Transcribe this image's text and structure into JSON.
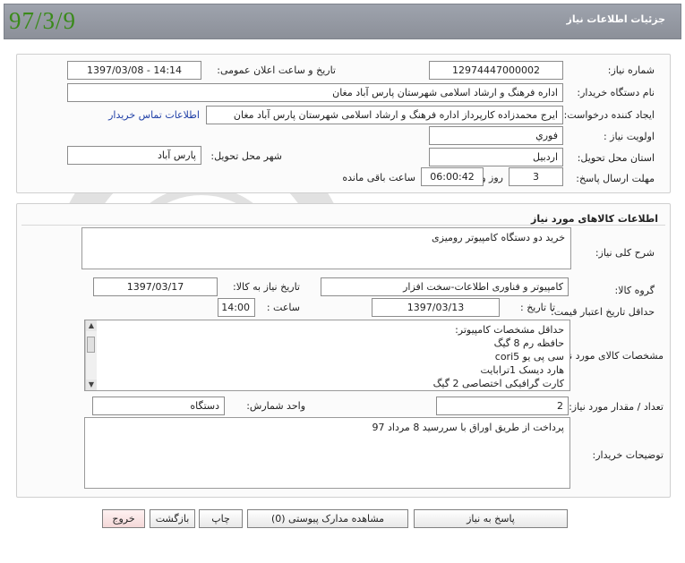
{
  "header": {
    "title": "جزئیات اطلاعات نیاز",
    "stamp": "97/3/9"
  },
  "info": {
    "need_number_label": "شماره نیاز:",
    "need_number": "12974447000002",
    "announce_label": "تاریخ و ساعت اعلان عمومی:",
    "announce_value": "1397/03/08 - 14:14",
    "buyer_label": "نام دستگاه خریدار:",
    "buyer": "اداره فرهنگ و ارشاد اسلامی شهرستان پارس آباد مغان",
    "requester_label": "ایجاد کننده درخواست:",
    "requester": "ایرج محمدزاده کارپرداز اداره فرهنگ و ارشاد اسلامی شهرستان پارس آباد مغان",
    "contact_link": "اطلاعات تماس خریدار",
    "priority_label": "اولویت نیاز :",
    "priority": "فوري",
    "province_label": "استان محل تحویل:",
    "province": "اردبیل",
    "city_label": "شهر محل تحویل:",
    "city": "پارس آباد",
    "deadline_label": "مهلت ارسال پاسخ:",
    "days": "3",
    "days_word": "روز و",
    "time": "06:00:42",
    "time_word": "ساعت باقی مانده"
  },
  "goods": {
    "section_title": "اطلاعات کالاهای مورد نیاز",
    "summary_label": "شرح کلی نیاز:",
    "summary": "خرید دو دستگاه کامپیوتر رومیزی",
    "group_label": "گروه کالا:",
    "group": "کامپیوتر و فناوری اطلاعات-سخت افزار",
    "need_date_label": "تاریخ نیاز به کالا:",
    "need_date": "1397/03/17",
    "validity_label": "حداقل تاریخ اعتبار قیمت:",
    "until_label": "تا تاریخ :",
    "until_date": "1397/03/13",
    "hour_label": "ساعت :",
    "hour": "14:00",
    "specs_label": "مشخصات کالای مورد نیاز:",
    "specs": [
      "حداقل مشخصات کامپیوتر:",
      "حافظه رم 8 گیگ",
      "سی پی یو cori5",
      "هارد دیسک 1ترابایت",
      "کارت گرافیکی اختصاصی 2 گیگ"
    ],
    "qty_label": "تعداد / مقدار مورد نیاز:",
    "qty": "2",
    "unit_label": "واحد شمارش:",
    "unit": "دستگاه",
    "buyer_notes_label": "توضیحات خریدار:",
    "buyer_notes": "پرداخت از طریق اوراق با سررسید 8 مرداد 97"
  },
  "buttons": {
    "reply": "پاسخ به نیاز",
    "attachments": "مشاهده مدارک پیوستی (0)",
    "print": "چاپ",
    "back": "بازگشت",
    "exit": "خروج"
  }
}
